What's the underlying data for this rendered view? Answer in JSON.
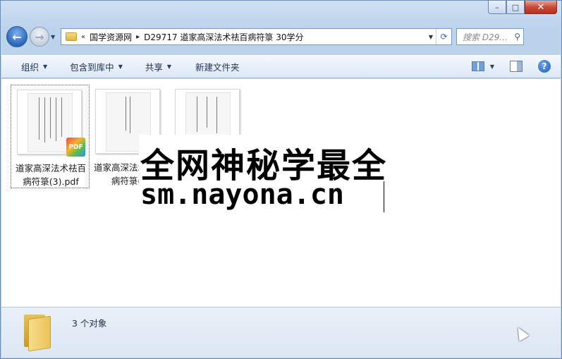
{
  "window": {
    "caption_buttons": {
      "minimize": "–",
      "maximize": "□",
      "close": "✕"
    }
  },
  "nav": {
    "back_icon": "back-arrow-icon",
    "forward_icon": "forward-arrow-icon",
    "address": {
      "overflow": "«",
      "crumbs": [
        "国学资源网",
        "D29717 道家高深法术祛百病符箓 30学分"
      ],
      "separator": "▸"
    },
    "search_placeholder": "搜索 D29..."
  },
  "toolbar": {
    "organize": "组织",
    "include_library": "包含到库中",
    "share": "共享",
    "new_folder": "新建文件夹"
  },
  "files": [
    {
      "name": "道家高深法术祛百病符箓(3).pdf",
      "selected": true,
      "badge": "PDF"
    },
    {
      "name": "道家高深法术祛百病符箓(1).pdf",
      "visible_name": "道家高深法术祛百病符箓(1",
      "selected": false
    },
    {
      "name": "",
      "selected": false
    }
  ],
  "watermark": {
    "line1": "全网神秘学最全",
    "line2": "sm.nayona.cn"
  },
  "details": {
    "count_text": "3 个对象"
  }
}
